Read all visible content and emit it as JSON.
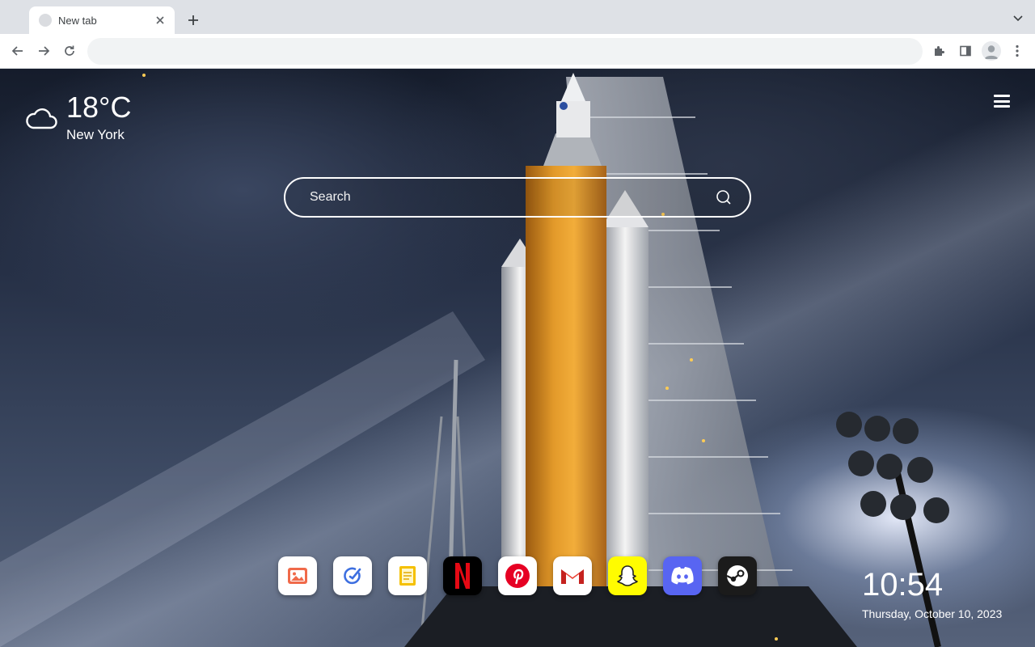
{
  "browser": {
    "tab": {
      "title": "New tab"
    },
    "omnibox": {
      "value": "",
      "placeholder": ""
    }
  },
  "weather": {
    "temperature": "18°C",
    "city": "New York",
    "icon": "cloud-icon"
  },
  "search": {
    "placeholder": "Search"
  },
  "dock": {
    "apps": [
      {
        "name": "Gallery",
        "icon": "image-icon",
        "color": "#e8543c"
      },
      {
        "name": "Tasks",
        "icon": "check-circle-icon",
        "color": "#3d6fe0"
      },
      {
        "name": "Notes",
        "icon": "note-icon",
        "color": "#f1b400"
      },
      {
        "name": "Netflix",
        "icon": "netflix-icon",
        "color": "#e50914"
      },
      {
        "name": "Pinterest",
        "icon": "pinterest-icon",
        "color": "#e60023"
      },
      {
        "name": "Gmail",
        "icon": "gmail-icon",
        "color": "#ea4335"
      },
      {
        "name": "Snapchat",
        "icon": "snapchat-icon",
        "color": "#fffc00"
      },
      {
        "name": "Discord",
        "icon": "discord-icon",
        "color": "#5865f2"
      },
      {
        "name": "Steam",
        "icon": "steam-icon",
        "color": "#1b1b1b"
      }
    ]
  },
  "clock": {
    "time": "10:54",
    "date": "Thursday, October 10, 2023"
  }
}
